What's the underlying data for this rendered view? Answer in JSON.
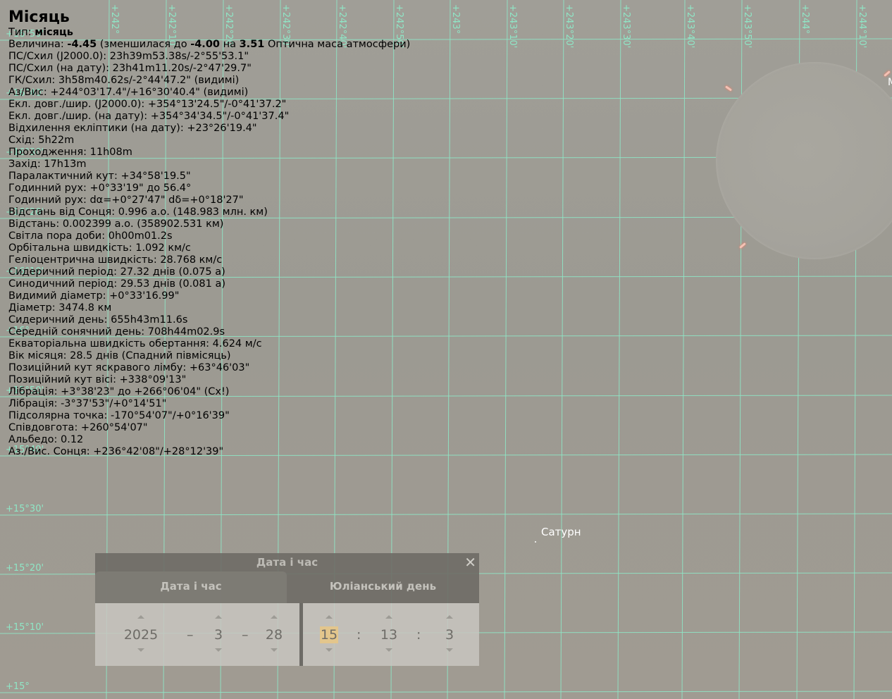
{
  "sky": {
    "ra_labels": [
      "+242°",
      "+242°10'",
      "+242°20'",
      "+242°30'",
      "+242°40'",
      "+242°50'",
      "+243°",
      "+243°10'",
      "+243°20'",
      "+243°30'",
      "+243°40'",
      "+243°50'",
      "+244°",
      "+244°10'"
    ],
    "dec_labels": [
      "+16°50'",
      "+16°40'",
      "+16°30'",
      "+16°20'",
      "+16°10'",
      "+16°",
      "+15°50'",
      "+15°40'",
      "+15°30'",
      "+15°20'",
      "+15°10'",
      "+15°"
    ],
    "grid_color": "#8fe6c6",
    "background_color": "#9e9c95",
    "saturn_label": "Сатурн",
    "edge_label": "М"
  },
  "info": {
    "title": "Місяць",
    "type_prefix": "Тип:",
    "type_value": "місяць",
    "mag_prefix": "Величина:",
    "mag_value": "-4.45",
    "mag_middle": "(зменшилася до",
    "mag_extinct": "-4.00",
    "mag_on": "на",
    "airmass": "3.51",
    "mag_suffix": "Оптична маса атмосфери)",
    "lines": [
      "ПС/Схил (J2000.0): 23h39m53.38s/-2°55'53.1\"",
      "ПС/Схил (на дату): 23h41m11.20s/-2°47'29.7\"",
      "ГК/Схил: 3h58m40.62s/-2°44'47.2\" (видимі)",
      "Аз/Вис: +244°03'17.4\"/+16°30'40.4\" (видимі)",
      "Екл. довг./шир. (J2000.0): +354°13'24.5\"/-0°41'37.2\"",
      "Екл. довг./шир. (на дату): +354°34'34.5\"/-0°41'37.4\"",
      "Відхилення екліптики (на дату): +23°26'19.4\"",
      "Схід: 5h22m",
      "Проходження: 11h08m",
      "Захід: 17h13m",
      "Паралактичний кут: +34°58'19.5\"",
      "Годинний рух: +0°33'19\" до 56.4°",
      "Годинний рух: dα=+0°27'47\" dδ=+0°18'27\"",
      "Відстань від Сонця: 0.996 а.о. (148.983 млн. км)",
      "Відстань: 0.002399 а.о. (358902.531 км)",
      "Світла пора доби: 0h00m01.2s",
      "Орбітальна швидкість: 1.092 км/с",
      "Геліоцентрична швидкість: 28.768 км/с",
      "Сидеричний період: 27.32 днів (0.075 а)",
      "Синодичний період: 29.53 днів (0.081 а)",
      "Видимий діаметр: +0°33'16.99\"",
      "Діаметр: 3474.8 км",
      "Сидеричний день: 655h43m11.6s",
      "Середній сонячний день: 708h44m02.9s",
      "Екваторіальна швидкість обертання: 4.624 м/с",
      "Вік місяця: 28.5 днів (Спадний півмісяць)",
      "Позиційний кут яскравого лімбу: +63°46'03\"",
      "Позиційний кут вісі: +338°09'13\"",
      "Лібрація: +3°38'23\" до +266°06'04\" (Сх!)",
      "Лібрація: -3°37'53\"/+0°14'51\"",
      "Підсолярна точка: -170°54'07\"/+0°16'39\"",
      "Співдовгота: +260°54'07\"",
      "Альбедо: 0.12",
      "Аз./Вис. Сонця: +236°42'08\"/+28°12'39\""
    ]
  },
  "dialog": {
    "title": "Дата і час",
    "close_glyph": "✕",
    "tab_date": "Дата і час",
    "tab_jd": "Юліанський день",
    "year": "2025",
    "month": "3",
    "day": "28",
    "hour": "15",
    "minute": "13",
    "second": "3",
    "date_sep": "–",
    "time_sep": ":",
    "highlight_color": "#e3c68c"
  }
}
